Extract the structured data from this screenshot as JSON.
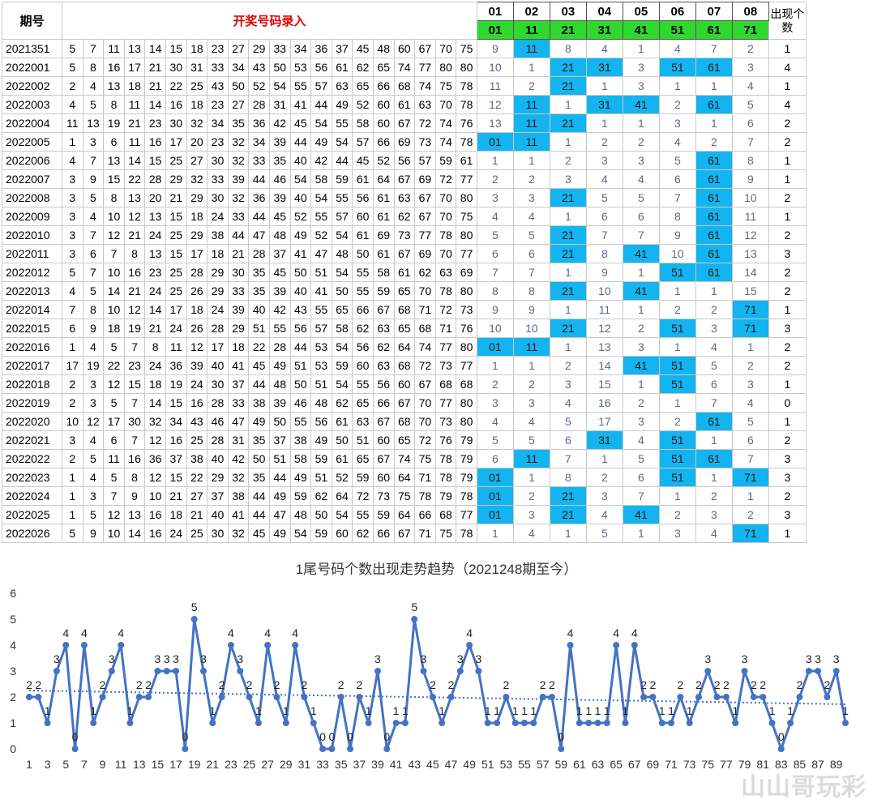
{
  "header": {
    "period_label": "期号",
    "entry_label": "开奖号码录入",
    "tail_numbers": [
      "01",
      "02",
      "03",
      "04",
      "05",
      "06",
      "07",
      "08"
    ],
    "tail_values": [
      "01",
      "11",
      "21",
      "31",
      "41",
      "51",
      "61",
      "71"
    ],
    "count_label": "出现个数"
  },
  "rows": [
    {
      "period": "2021351",
      "nums": [
        5,
        7,
        11,
        13,
        14,
        15,
        18,
        23,
        27,
        29,
        33,
        34,
        36,
        37,
        45,
        48,
        60,
        67,
        70,
        75
      ],
      "tails": [
        "9",
        "11",
        "8",
        "4",
        "1",
        "4",
        "7",
        "2"
      ],
      "hits": [
        2
      ],
      "count": "1"
    },
    {
      "period": "2022001",
      "nums": [
        5,
        8,
        16,
        17,
        21,
        30,
        31,
        33,
        34,
        43,
        50,
        53,
        56,
        61,
        62,
        65,
        74,
        77,
        80,
        80
      ],
      "tails": [
        "10",
        "1",
        "21",
        "31",
        "3",
        "51",
        "61",
        "3"
      ],
      "hits": [
        3,
        4,
        6,
        7
      ],
      "count": "4"
    },
    {
      "period": "2022002",
      "nums": [
        2,
        4,
        13,
        18,
        21,
        22,
        25,
        43,
        50,
        52,
        54,
        55,
        57,
        63,
        65,
        66,
        68,
        74,
        75,
        78
      ],
      "tails": [
        "11",
        "2",
        "21",
        "1",
        "3",
        "1",
        "1",
        "4"
      ],
      "hits": [
        3
      ],
      "count": "1"
    },
    {
      "period": "2022003",
      "nums": [
        4,
        5,
        8,
        11,
        14,
        16,
        18,
        23,
        27,
        28,
        31,
        41,
        44,
        49,
        52,
        60,
        61,
        63,
        70,
        78
      ],
      "tails": [
        "12",
        "11",
        "1",
        "31",
        "41",
        "2",
        "61",
        "5"
      ],
      "hits": [
        2,
        4,
        5,
        7
      ],
      "count": "4"
    },
    {
      "period": "2022004",
      "nums": [
        11,
        13,
        19,
        21,
        23,
        30,
        32,
        34,
        35,
        36,
        42,
        45,
        54,
        55,
        58,
        60,
        67,
        72,
        74,
        76
      ],
      "tails": [
        "13",
        "11",
        "21",
        "1",
        "1",
        "3",
        "1",
        "6"
      ],
      "hits": [
        2,
        3
      ],
      "count": "2"
    },
    {
      "period": "2022005",
      "nums": [
        1,
        3,
        6,
        11,
        16,
        17,
        20,
        23,
        32,
        34,
        39,
        44,
        49,
        54,
        57,
        66,
        69,
        73,
        74,
        78
      ],
      "tails": [
        "01",
        "11",
        "1",
        "2",
        "2",
        "4",
        "2",
        "7"
      ],
      "hits": [
        1,
        2
      ],
      "count": "2"
    },
    {
      "period": "2022006",
      "nums": [
        4,
        7,
        13,
        14,
        15,
        25,
        27,
        30,
        32,
        33,
        35,
        40,
        42,
        44,
        45,
        52,
        56,
        57,
        59,
        61
      ],
      "tails": [
        "1",
        "1",
        "2",
        "3",
        "3",
        "5",
        "61",
        "8"
      ],
      "hits": [
        7
      ],
      "count": "1"
    },
    {
      "period": "2022007",
      "nums": [
        3,
        9,
        15,
        22,
        28,
        29,
        32,
        33,
        39,
        44,
        46,
        54,
        58,
        59,
        61,
        64,
        67,
        69,
        72,
        77
      ],
      "tails": [
        "2",
        "2",
        "3",
        "4",
        "4",
        "6",
        "61",
        "9"
      ],
      "hits": [
        7
      ],
      "count": "1"
    },
    {
      "period": "2022008",
      "nums": [
        3,
        5,
        8,
        13,
        20,
        21,
        29,
        30,
        32,
        36,
        39,
        40,
        54,
        55,
        56,
        61,
        63,
        67,
        70,
        80
      ],
      "tails": [
        "3",
        "3",
        "21",
        "5",
        "5",
        "7",
        "61",
        "10"
      ],
      "hits": [
        3,
        7
      ],
      "count": "2"
    },
    {
      "period": "2022009",
      "nums": [
        3,
        4,
        10,
        12,
        13,
        15,
        18,
        24,
        33,
        44,
        45,
        52,
        55,
        57,
        60,
        61,
        62,
        67,
        70,
        75
      ],
      "tails": [
        "4",
        "4",
        "1",
        "6",
        "6",
        "8",
        "61",
        "11"
      ],
      "hits": [
        7
      ],
      "count": "1"
    },
    {
      "period": "2022010",
      "nums": [
        3,
        7,
        12,
        21,
        24,
        25,
        29,
        38,
        44,
        47,
        48,
        49,
        52,
        54,
        61,
        69,
        73,
        77,
        78,
        80
      ],
      "tails": [
        "5",
        "5",
        "21",
        "7",
        "7",
        "9",
        "61",
        "12"
      ],
      "hits": [
        3,
        7
      ],
      "count": "2"
    },
    {
      "period": "2022011",
      "nums": [
        3,
        6,
        7,
        8,
        13,
        15,
        17,
        18,
        21,
        28,
        37,
        41,
        47,
        48,
        50,
        61,
        67,
        69,
        70,
        77
      ],
      "tails": [
        "6",
        "6",
        "21",
        "8",
        "41",
        "10",
        "61",
        "13"
      ],
      "hits": [
        3,
        5,
        7
      ],
      "count": "3"
    },
    {
      "period": "2022012",
      "nums": [
        5,
        7,
        10,
        16,
        23,
        25,
        28,
        29,
        30,
        35,
        45,
        50,
        51,
        54,
        55,
        58,
        61,
        62,
        63,
        69
      ],
      "tails": [
        "7",
        "7",
        "1",
        "9",
        "1",
        "51",
        "61",
        "14"
      ],
      "hits": [
        6,
        7
      ],
      "count": "2"
    },
    {
      "period": "2022013",
      "nums": [
        4,
        5,
        14,
        21,
        24,
        25,
        26,
        29,
        33,
        35,
        39,
        40,
        41,
        50,
        55,
        59,
        65,
        70,
        78,
        80
      ],
      "tails": [
        "8",
        "8",
        "21",
        "10",
        "41",
        "1",
        "1",
        "15"
      ],
      "hits": [
        3,
        5
      ],
      "count": "2"
    },
    {
      "period": "2022014",
      "nums": [
        7,
        8,
        10,
        12,
        14,
        17,
        18,
        24,
        39,
        40,
        42,
        43,
        55,
        65,
        66,
        67,
        68,
        71,
        72,
        73
      ],
      "tails": [
        "9",
        "9",
        "1",
        "11",
        "1",
        "2",
        "2",
        "71"
      ],
      "hits": [
        8
      ],
      "count": "1"
    },
    {
      "period": "2022015",
      "nums": [
        6,
        9,
        18,
        19,
        21,
        24,
        26,
        28,
        29,
        51,
        55,
        56,
        57,
        58,
        62,
        63,
        65,
        68,
        71,
        76
      ],
      "tails": [
        "10",
        "10",
        "21",
        "12",
        "2",
        "51",
        "3",
        "71"
      ],
      "hits": [
        3,
        6,
        8
      ],
      "count": "3"
    },
    {
      "period": "2022016",
      "nums": [
        1,
        4,
        5,
        7,
        8,
        11,
        12,
        17,
        18,
        22,
        28,
        44,
        53,
        54,
        56,
        62,
        64,
        74,
        77,
        80
      ],
      "tails": [
        "01",
        "11",
        "1",
        "13",
        "3",
        "1",
        "4",
        "1"
      ],
      "hits": [
        1,
        2
      ],
      "count": "2"
    },
    {
      "period": "2022017",
      "nums": [
        17,
        19,
        22,
        23,
        24,
        36,
        39,
        40,
        41,
        45,
        49,
        51,
        53,
        59,
        60,
        63,
        68,
        72,
        73,
        77
      ],
      "tails": [
        "1",
        "1",
        "2",
        "14",
        "41",
        "51",
        "5",
        "2"
      ],
      "hits": [
        5,
        6
      ],
      "count": "2"
    },
    {
      "period": "2022018",
      "nums": [
        2,
        3,
        12,
        15,
        18,
        19,
        24,
        30,
        37,
        44,
        48,
        50,
        51,
        54,
        55,
        56,
        60,
        67,
        68,
        68
      ],
      "tails": [
        "2",
        "2",
        "3",
        "15",
        "1",
        "51",
        "6",
        "3"
      ],
      "hits": [
        6
      ],
      "count": "1"
    },
    {
      "period": "2022019",
      "nums": [
        2,
        3,
        5,
        7,
        14,
        15,
        16,
        28,
        33,
        38,
        39,
        46,
        48,
        62,
        65,
        66,
        67,
        70,
        77,
        80
      ],
      "tails": [
        "3",
        "3",
        "4",
        "16",
        "2",
        "1",
        "7",
        "4"
      ],
      "hits": [],
      "count": "0"
    },
    {
      "period": "2022020",
      "nums": [
        10,
        12,
        17,
        30,
        32,
        34,
        43,
        46,
        47,
        49,
        50,
        55,
        56,
        61,
        63,
        67,
        68,
        70,
        73,
        80
      ],
      "tails": [
        "4",
        "4",
        "5",
        "17",
        "3",
        "2",
        "61",
        "5"
      ],
      "hits": [
        7
      ],
      "count": "1"
    },
    {
      "period": "2022021",
      "nums": [
        3,
        4,
        6,
        7,
        12,
        16,
        25,
        28,
        31,
        35,
        37,
        38,
        49,
        50,
        51,
        60,
        65,
        72,
        76,
        79
      ],
      "tails": [
        "5",
        "5",
        "6",
        "31",
        "4",
        "51",
        "1",
        "6"
      ],
      "hits": [
        4,
        6
      ],
      "count": "2"
    },
    {
      "period": "2022022",
      "nums": [
        2,
        5,
        11,
        16,
        36,
        37,
        38,
        40,
        42,
        50,
        51,
        58,
        59,
        61,
        65,
        67,
        74,
        75,
        78,
        79
      ],
      "tails": [
        "6",
        "11",
        "7",
        "1",
        "5",
        "51",
        "61",
        "7"
      ],
      "hits": [
        2,
        6,
        7
      ],
      "count": "3"
    },
    {
      "period": "2022023",
      "nums": [
        1,
        4,
        5,
        8,
        12,
        15,
        22,
        29,
        32,
        35,
        44,
        49,
        51,
        52,
        59,
        60,
        64,
        71,
        78,
        79
      ],
      "tails": [
        "01",
        "1",
        "8",
        "2",
        "6",
        "51",
        "1",
        "71"
      ],
      "hits": [
        1,
        6,
        8
      ],
      "count": "3"
    },
    {
      "period": "2022024",
      "nums": [
        1,
        3,
        7,
        9,
        10,
        21,
        27,
        37,
        38,
        44,
        49,
        59,
        62,
        64,
        72,
        73,
        75,
        78,
        79,
        78
      ],
      "tails": [
        "01",
        "2",
        "21",
        "3",
        "7",
        "1",
        "2",
        "1"
      ],
      "hits": [
        1,
        3
      ],
      "count": "2"
    },
    {
      "period": "2022025",
      "nums": [
        1,
        5,
        12,
        13,
        16,
        18,
        21,
        40,
        41,
        44,
        47,
        48,
        50,
        54,
        55,
        59,
        64,
        66,
        68,
        77
      ],
      "tails": [
        "01",
        "3",
        "21",
        "4",
        "41",
        "2",
        "3",
        "2"
      ],
      "hits": [
        1,
        3,
        5
      ],
      "count": "3"
    },
    {
      "period": "2022026",
      "nums": [
        5,
        9,
        10,
        14,
        16,
        24,
        25,
        30,
        32,
        45,
        49,
        54,
        59,
        60,
        62,
        66,
        67,
        71,
        75,
        78
      ],
      "tails": [
        "1",
        "4",
        "1",
        "5",
        "1",
        "3",
        "4",
        "71"
      ],
      "hits": [
        8
      ],
      "count": "1"
    }
  ],
  "chart_data": {
    "type": "line",
    "title": "1尾号码个数出现走势趋势（2021248期至今）",
    "xlabel": "",
    "ylabel": "",
    "ylim": [
      0,
      6
    ],
    "yticks": [
      0,
      1,
      2,
      3,
      4,
      5,
      6
    ],
    "x_tick_labels": [
      1,
      3,
      5,
      7,
      9,
      11,
      13,
      15,
      17,
      19,
      21,
      23,
      25,
      27,
      29,
      31,
      33,
      35,
      37,
      39,
      41,
      43,
      45,
      47,
      49,
      51,
      53,
      55,
      57,
      59,
      61,
      63,
      65,
      67,
      69,
      71,
      73,
      75,
      77,
      79,
      81,
      83,
      85,
      87,
      89
    ],
    "x": [
      1,
      2,
      3,
      4,
      5,
      6,
      7,
      8,
      9,
      10,
      11,
      12,
      13,
      14,
      15,
      16,
      17,
      18,
      19,
      20,
      21,
      22,
      23,
      24,
      25,
      26,
      27,
      28,
      29,
      30,
      31,
      32,
      33,
      34,
      35,
      36,
      37,
      38,
      39,
      40,
      41,
      42,
      43,
      44,
      45,
      46,
      47,
      48,
      49,
      50,
      51,
      52,
      53,
      54,
      55,
      56,
      57,
      58,
      59,
      60,
      61,
      62,
      63,
      64,
      65,
      66,
      67,
      68,
      69,
      70,
      71,
      72,
      73,
      74,
      75,
      76,
      77,
      78,
      79,
      80,
      81,
      82,
      83,
      84,
      85,
      86,
      87,
      88,
      89,
      90
    ],
    "series": [
      {
        "values": [
          2,
          2,
          1,
          3,
          4,
          0,
          4,
          1,
          2,
          3,
          4,
          1,
          2,
          2,
          3,
          3,
          3,
          0,
          5,
          3,
          1,
          2,
          4,
          3,
          2,
          1,
          4,
          2,
          1,
          4,
          2,
          1,
          0,
          0,
          2,
          0,
          2,
          1,
          3,
          0,
          1,
          1,
          5,
          3,
          2,
          1,
          2,
          3,
          4,
          3,
          1,
          1,
          2,
          1,
          1,
          1,
          2,
          2,
          0,
          4,
          1,
          1,
          1,
          1,
          4,
          1,
          4,
          2,
          2,
          1,
          1,
          2,
          1,
          2,
          3,
          2,
          2,
          1,
          3,
          2,
          2,
          1,
          0,
          1,
          2,
          3,
          3,
          2,
          3,
          1
        ]
      }
    ],
    "trendline": {
      "style": "dotted linear",
      "start": 2.25,
      "end": 1.72
    },
    "grid": false,
    "colors": {
      "line": "#4472c4",
      "trend": "#4472c4"
    }
  },
  "watermark": "山山哥玩彩"
}
